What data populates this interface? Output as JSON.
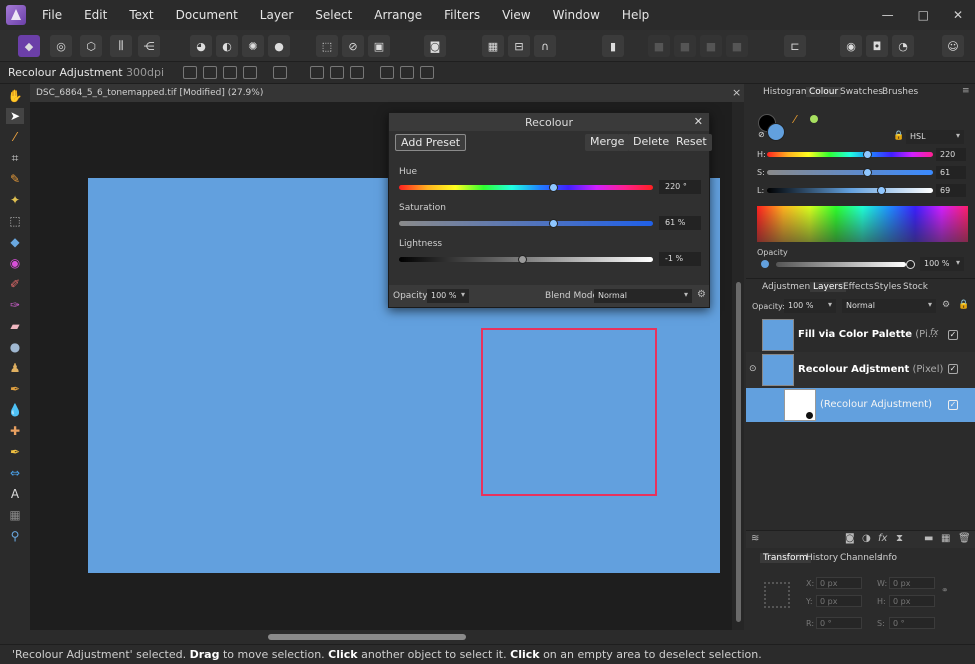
{
  "menu": [
    "File",
    "Edit",
    "Text",
    "Document",
    "Layer",
    "Select",
    "Arrange",
    "Filters",
    "View",
    "Window",
    "Help"
  ],
  "window_controls": [
    "—",
    "□",
    "✕"
  ],
  "context": {
    "title": "Recolour Adjustment",
    "dpi": "300dpi"
  },
  "document": {
    "tab_title": "DSC_6864_5_6_tonemapped.tif [Modified] (27.9%)",
    "close": "×"
  },
  "dialog": {
    "title": "Recolour",
    "close": "✕",
    "buttons": {
      "add_preset": "Add Preset",
      "merge": "Merge",
      "delete": "Delete",
      "reset": "Reset"
    },
    "hue": {
      "label": "Hue",
      "value": "220 °",
      "fraction": 0.61
    },
    "saturation": {
      "label": "Saturation",
      "value": "61 %",
      "fraction": 0.61
    },
    "lightness": {
      "label": "Lightness",
      "value": "-1 %",
      "fraction": 0.49
    },
    "opacity_label": "Opacity:",
    "opacity_value": "100 %",
    "blend_label": "Blend Mode:",
    "blend_value": "Normal"
  },
  "colour_panel": {
    "tabs": [
      "Histogram",
      "Colour",
      "Swatches",
      "Brushes"
    ],
    "active_tab": "Colour",
    "model": "HSL",
    "h": {
      "label": "H:",
      "value": "220",
      "fraction": 0.61
    },
    "s": {
      "label": "S:",
      "value": "61",
      "fraction": 0.61
    },
    "l": {
      "label": "L:",
      "value": "69",
      "fraction": 0.69
    },
    "opacity_label": "Opacity",
    "opacity_value": "100 %",
    "colors": {
      "fill": "#62a0de",
      "accent": "#8ec6ff"
    }
  },
  "layers_panel": {
    "tabs": [
      "Adjustment",
      "Layers",
      "Effects",
      "Styles",
      "Stock"
    ],
    "active_tab": "Layers",
    "opacity_label": "Opacity:",
    "opacity_value": "100 %",
    "blend_value": "Normal",
    "layers": [
      {
        "name": "Fill via Color Palette",
        "kind": " (Pi...",
        "fx": "fx"
      },
      {
        "name": "Recolour Adjstment",
        "kind": " (Pixel)"
      },
      {
        "name": "(Recolour Adjustment)",
        "kind": ""
      }
    ]
  },
  "transform_panel": {
    "tabs": [
      "Transform",
      "History",
      "Channels",
      "Info"
    ],
    "active_tab": "Transform",
    "fields": {
      "x_label": "X:",
      "x": "0 px",
      "y_label": "Y:",
      "y": "0 px",
      "w_label": "W:",
      "w": "0 px",
      "h_label": "H:",
      "h": "0 px",
      "r_label": "R:",
      "r": "0 °",
      "s_label": "S:",
      "s": "0 °"
    }
  },
  "status": {
    "s1": "'Recolour Adjustment' selected. ",
    "b1": "Drag",
    "s2": " to move selection. ",
    "b2": "Click",
    "s3": " another object to select it. ",
    "b3": "Click",
    "s4": " on an empty area to deselect selection."
  }
}
